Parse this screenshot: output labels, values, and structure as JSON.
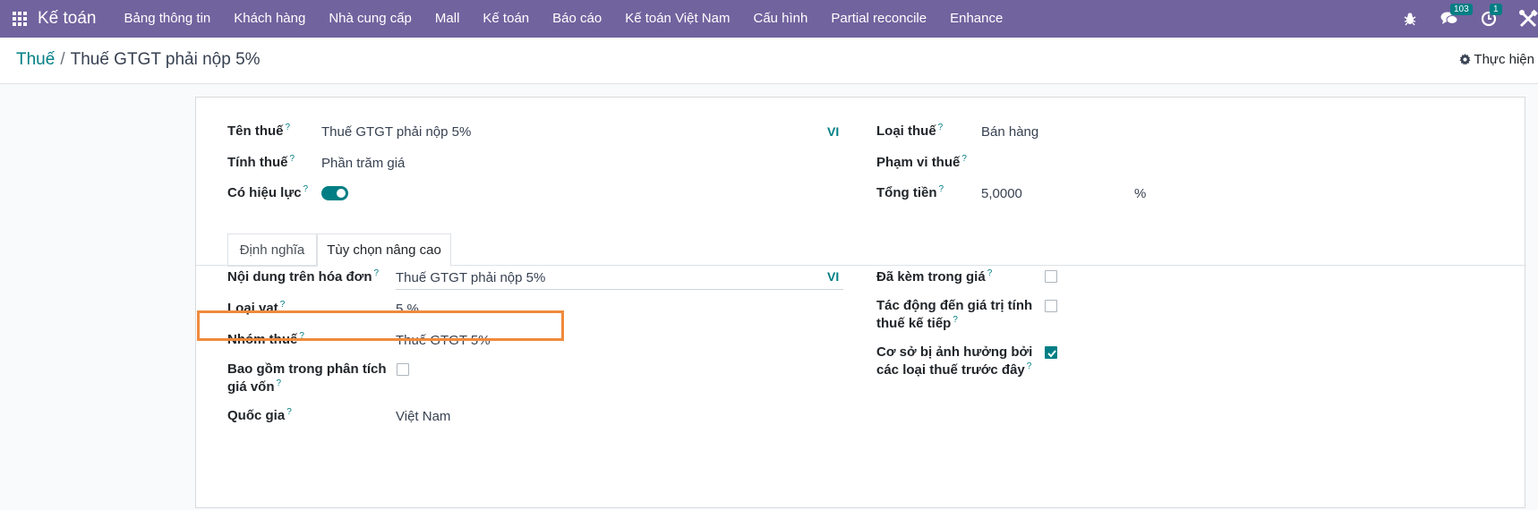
{
  "navbar": {
    "app_name": "Kế toán",
    "menu": [
      "Bảng thông tin",
      "Khách hàng",
      "Nhà cung cấp",
      "Mall",
      "Kế toán",
      "Báo cáo",
      "Kế toán Việt Nam",
      "Cấu hình",
      "Partial reconcile",
      "Enhance"
    ],
    "messages_count": "103",
    "activities_count": "1"
  },
  "breadcrumb": {
    "parent": "Thuế",
    "separator": "/",
    "current": "Thuế GTGT phải nộp 5%"
  },
  "actions": {
    "label": "Thực hiện"
  },
  "form": {
    "tax_name": {
      "label": "Tên thuế",
      "value": "Thuế GTGT phải nộp 5%",
      "lang": "VI"
    },
    "tax_computation": {
      "label": "Tính thuế",
      "value": "Phần trăm giá"
    },
    "active": {
      "label": "Có hiệu lực",
      "value": true
    },
    "tax_type": {
      "label": "Loại thuế",
      "value": "Bán hàng"
    },
    "tax_scope": {
      "label": "Phạm vi thuế",
      "value": ""
    },
    "amount": {
      "label": "Tổng tiền",
      "value": "5,0000",
      "unit": "%"
    }
  },
  "tabs": [
    "Định nghĩa",
    "Tùy chọn nâng cao"
  ],
  "advanced": {
    "invoice_label": {
      "label": "Nội dung trên hóa đơn",
      "value": "Thuế GTGT phải nộp 5%",
      "lang": "VI"
    },
    "vat_type": {
      "label": "Loại vat",
      "value": "5 %"
    },
    "tax_group": {
      "label": "Nhóm thuế",
      "value": "Thuế GTGT 5%"
    },
    "analytic_cost": {
      "label_line1": "Bao gồm trong phân tích",
      "label_line2": "giá vốn",
      "checked": false
    },
    "country": {
      "label": "Quốc gia",
      "value": "Việt Nam"
    },
    "price_include": {
      "label": "Đã kèm trong giá",
      "checked": false
    },
    "include_base_amount": {
      "label_line1": "Tác động đến giá trị tính",
      "label_line2": "thuế kế tiếp",
      "checked": false
    },
    "is_base_affected": {
      "label_line1": "Cơ sở bị ảnh hưởng bởi",
      "label_line2": "các loại thuế trước đây",
      "checked": true
    }
  },
  "colors": {
    "navbar": "#71639e",
    "accent": "#017e84",
    "highlight": "#f08a3c"
  }
}
